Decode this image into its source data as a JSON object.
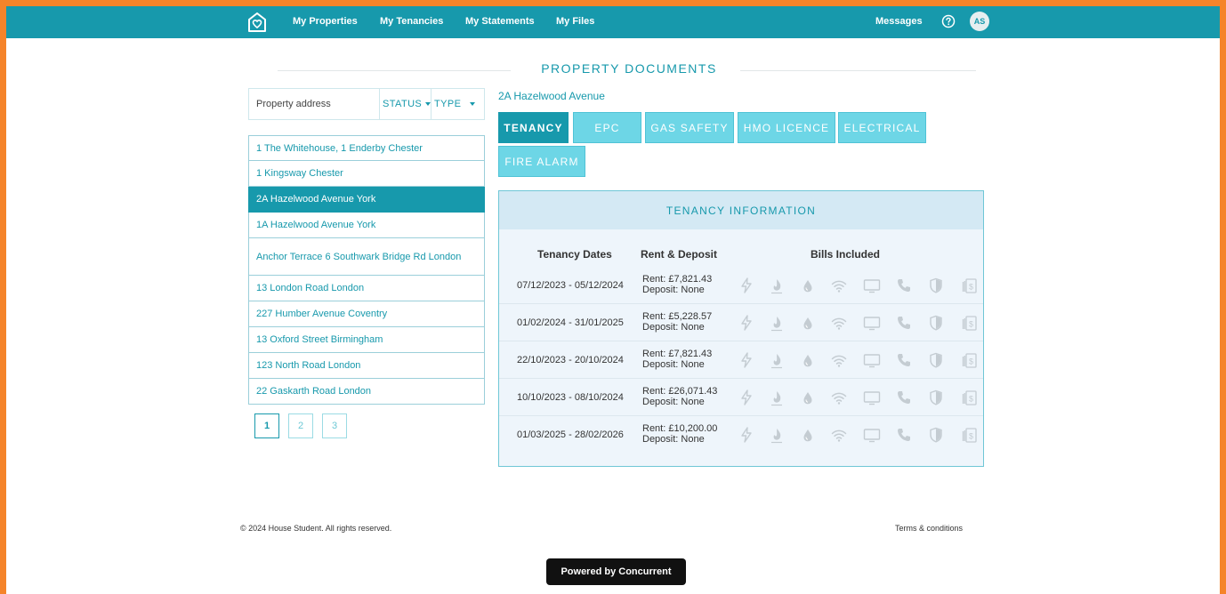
{
  "nav": {
    "links": [
      "My Properties",
      "My Tenancies",
      "My Statements",
      "My Files"
    ],
    "messages": "Messages",
    "avatar_initials": "AS"
  },
  "page": {
    "title": "PROPERTY DOCUMENTS"
  },
  "filters": {
    "address_placeholder": "Property address",
    "status_label": "STATUS",
    "type_label": "TYPE"
  },
  "properties": [
    "1 The Whitehouse, 1 Enderby Chester",
    "1 Kingsway Chester",
    "2A Hazelwood Avenue York",
    "1A Hazelwood Avenue York",
    "Anchor Terrace 6 Southwark Bridge Rd London",
    "13 London Road London",
    "227 Humber Avenue Coventry",
    "13 Oxford Street Birmingham",
    "123 North Road London",
    "22 Gaskarth Road London"
  ],
  "selected_property_index": 2,
  "pagination": {
    "pages": [
      "1",
      "2",
      "3"
    ],
    "current": "1"
  },
  "document": {
    "address": "2A Hazelwood Avenue",
    "tabs": [
      "TENANCY",
      "EPC",
      "GAS SAFETY",
      "HMO LICENCE",
      "ELECTRICAL",
      "FIRE ALARM"
    ],
    "active_tab": "TENANCY"
  },
  "tenancy": {
    "heading": "TENANCY INFORMATION",
    "columns": {
      "dates": "Tenancy Dates",
      "rent": "Rent & Deposit",
      "bills": "Bills Included"
    },
    "bill_icons": [
      "electricity-icon",
      "gas-flame-icon",
      "water-drop-icon",
      "wifi-icon",
      "tv-icon",
      "phone-icon",
      "insurance-shield-icon",
      "council-tax-icon"
    ],
    "rows": [
      {
        "dates": "07/12/2023 - 05/12/2024",
        "rent": "Rent: £7,821.43",
        "deposit": "Deposit: None"
      },
      {
        "dates": "01/02/2024 - 31/01/2025",
        "rent": "Rent: £5,228.57",
        "deposit": "Deposit: None"
      },
      {
        "dates": "22/10/2023 - 20/10/2024",
        "rent": "Rent: £7,821.43",
        "deposit": "Deposit: None"
      },
      {
        "dates": "10/10/2023 - 08/10/2024",
        "rent": "Rent: £26,071.43",
        "deposit": "Deposit: None"
      },
      {
        "dates": "01/03/2025 - 28/02/2026",
        "rent": "Rent: £10,200.00",
        "deposit": "Deposit: None"
      }
    ]
  },
  "footer": {
    "copyright": "© 2024 House Student. All rights reserved.",
    "terms": "Terms & conditions",
    "powered_by": "Powered by Concurrent"
  },
  "colors": {
    "brand": "#1799ac",
    "tab_inactive": "#6dd6e6",
    "frame_border": "#f5842a"
  }
}
